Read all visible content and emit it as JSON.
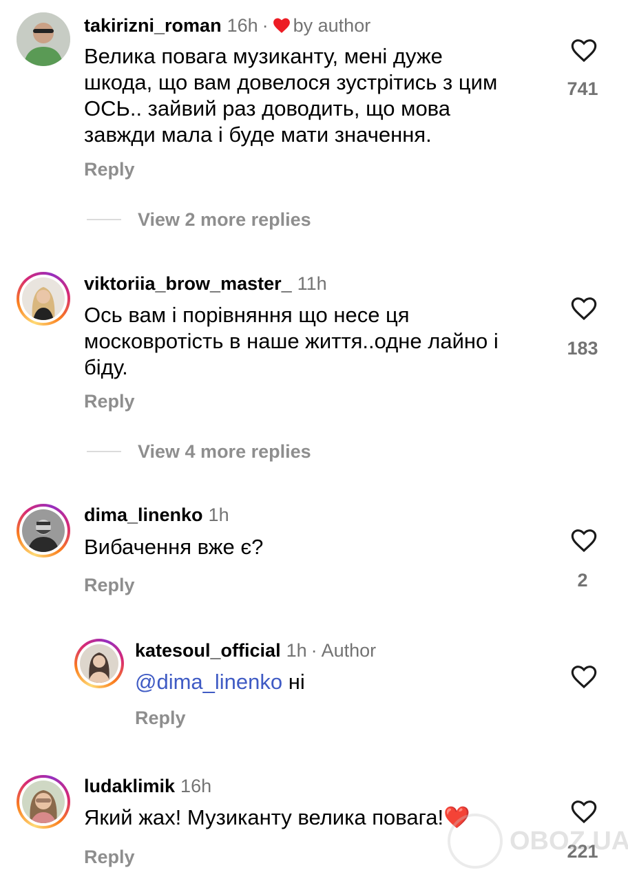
{
  "comments": [
    {
      "username": "takirizni_roman",
      "time": "16h",
      "separator": "·",
      "by_author": "by author",
      "text_lines": [
        "Велика повага музиканту, мені дуже",
        "шкода, що вам довелося зустрітись з цим",
        "ОСЬ.. зайвий раз доводить, що мова",
        "завжди мала і буде мати значення."
      ],
      "reply_label": "Reply",
      "likes": "741",
      "view_more": "View 2 more replies"
    },
    {
      "username": "viktoriia_brow_master_",
      "time": "11h",
      "text_lines": [
        "Ось вам і порівняння  що несе ця",
        "московротість в наше життя..одне лайно і",
        "біду."
      ],
      "reply_label": "Reply",
      "likes": "183",
      "view_more": "View 4 more replies"
    },
    {
      "username": "dima_linenko",
      "time": "1h",
      "text_lines": [
        "Вибачення вже є?"
      ],
      "reply_label": "Reply",
      "likes": "2",
      "reply": {
        "username": "katesoul_official",
        "time": "1h",
        "separator": "·",
        "author_badge": "Author",
        "mention": "@dima_linenko",
        "text": " ні",
        "reply_label": "Reply"
      }
    },
    {
      "username": "ludaklimik",
      "time": "16h",
      "text": "Який жах! Музиканту велика повага!",
      "emoji": "❤️",
      "reply_label": "Reply",
      "likes": "221"
    }
  ],
  "watermark": "OBOZ.UA",
  "colors": {
    "heart_red": "#ed1c24",
    "mention_blue": "#3f5bc4",
    "muted_gray": "#8e8e8e"
  },
  "icons": {
    "like": "heart-outline-icon",
    "author_like": "heart-filled-icon"
  }
}
